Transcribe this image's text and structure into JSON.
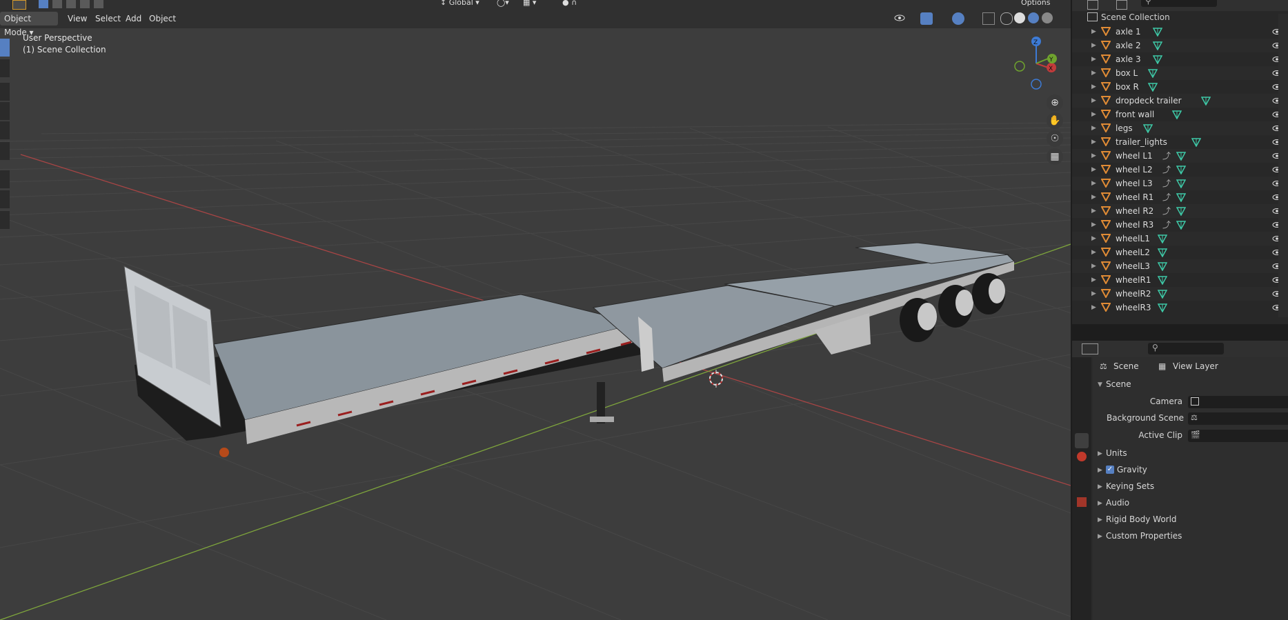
{
  "header": {
    "mode": "Object Mode",
    "menus": [
      "View",
      "Select",
      "Add",
      "Object"
    ],
    "orientation": "Global",
    "options": "Options"
  },
  "viewport": {
    "perspective": "User Perspective",
    "collection": "(1) Scene Collection",
    "gizmo_axes": {
      "x": "X",
      "y": "Y",
      "z": "Z"
    }
  },
  "outliner": {
    "root": "Scene Collection",
    "items": [
      {
        "label": "axle 1",
        "anim": false
      },
      {
        "label": "axle 2",
        "anim": false
      },
      {
        "label": "axle 3",
        "anim": false
      },
      {
        "label": "box L",
        "anim": false
      },
      {
        "label": "box R",
        "anim": false
      },
      {
        "label": "dropdeck trailer",
        "anim": false
      },
      {
        "label": "front wall",
        "anim": false
      },
      {
        "label": "legs",
        "anim": false
      },
      {
        "label": "trailer_lights",
        "anim": false
      },
      {
        "label": "wheel L1",
        "anim": true
      },
      {
        "label": "wheel L2",
        "anim": true
      },
      {
        "label": "wheel L3",
        "anim": true
      },
      {
        "label": "wheel R1",
        "anim": true
      },
      {
        "label": "wheel R2",
        "anim": true
      },
      {
        "label": "wheel R3",
        "anim": true
      },
      {
        "label": "wheelL1",
        "anim": false
      },
      {
        "label": "wheelL2",
        "anim": false
      },
      {
        "label": "wheelL3",
        "anim": false
      },
      {
        "label": "wheelR1",
        "anim": false
      },
      {
        "label": "wheelR2",
        "anim": false
      },
      {
        "label": "wheelR3",
        "anim": false
      }
    ]
  },
  "properties": {
    "breadcrumb_scene": "Scene",
    "breadcrumb_layer": "View Layer",
    "panel_title": "Scene",
    "fields": {
      "camera": "Camera",
      "background_scene": "Background Scene",
      "active_clip": "Active Clip"
    },
    "sections": [
      "Units",
      "Gravity",
      "Keying Sets",
      "Audio",
      "Rigid Body World",
      "Custom Properties"
    ],
    "gravity_checked": true
  },
  "colors": {
    "viewport_bg": "#3d3d3d",
    "x_axis": "#a84545",
    "y_axis": "#7ea53c",
    "mesh_icon": "#e08b35",
    "data_icon": "#3ec9a7",
    "accent": "#5680c2"
  }
}
